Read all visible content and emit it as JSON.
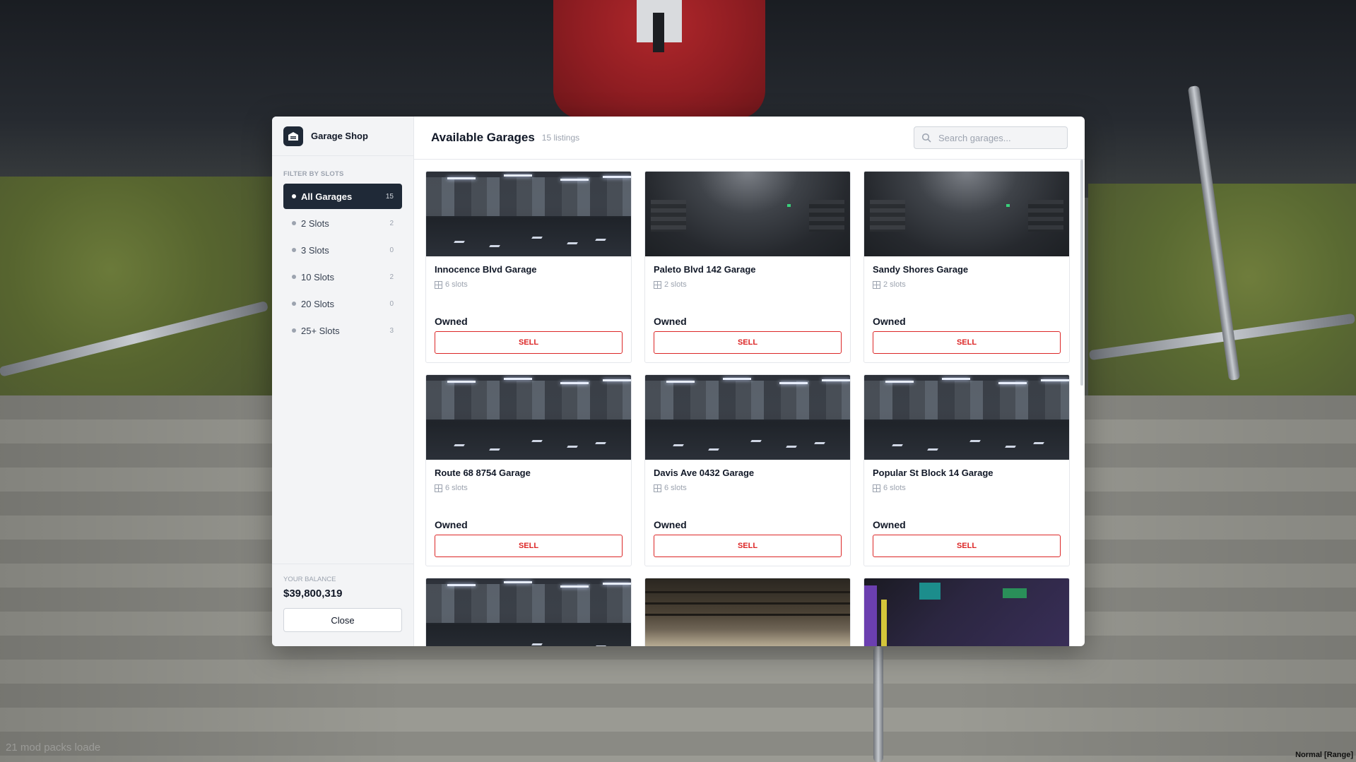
{
  "brand": {
    "title": "Garage Shop",
    "icon": "garage-icon"
  },
  "sidebar": {
    "filter_heading": "FILTER BY SLOTS",
    "filters": [
      {
        "label": "All Garages",
        "count": "15",
        "active": true
      },
      {
        "label": "2 Slots",
        "count": "2",
        "active": false
      },
      {
        "label": "3 Slots",
        "count": "0",
        "active": false
      },
      {
        "label": "10 Slots",
        "count": "2",
        "active": false
      },
      {
        "label": "20 Slots",
        "count": "0",
        "active": false
      },
      {
        "label": "25+ Slots",
        "count": "3",
        "active": false
      }
    ],
    "balance_label": "YOUR BALANCE",
    "balance_value": "$39,800,319",
    "close_label": "Close"
  },
  "header": {
    "title": "Available Garages",
    "listing_count": "15 listings",
    "search_placeholder": "Search garages...",
    "search_icon": "search-icon"
  },
  "garages": [
    {
      "name": "Innocence Blvd Garage",
      "slots": "6 slots",
      "status": "Owned",
      "action": "SELL",
      "thumb": "lit"
    },
    {
      "name": "Paleto Blvd 142 Garage",
      "slots": "2 slots",
      "status": "Owned",
      "action": "SELL",
      "thumb": "dark"
    },
    {
      "name": "Sandy Shores Garage",
      "slots": "2 slots",
      "status": "Owned",
      "action": "SELL",
      "thumb": "dark"
    },
    {
      "name": "Route 68 8754 Garage",
      "slots": "6 slots",
      "status": "Owned",
      "action": "SELL",
      "thumb": "lit"
    },
    {
      "name": "Davis Ave 0432 Garage",
      "slots": "6 slots",
      "status": "Owned",
      "action": "SELL",
      "thumb": "lit"
    },
    {
      "name": "Popular St Block 14 Garage",
      "slots": "6 slots",
      "status": "Owned",
      "action": "SELL",
      "thumb": "lit"
    },
    {
      "name": "",
      "slots": "",
      "status": "",
      "action": "",
      "thumb": "lit"
    },
    {
      "name": "",
      "slots": "",
      "status": "",
      "action": "",
      "thumb": "warehouse"
    },
    {
      "name": "",
      "slots": "",
      "status": "",
      "action": "",
      "thumb": "club"
    }
  ],
  "overlay": {
    "bottom_left": "21 mod packs loade",
    "bottom_right": "Normal [Range]"
  },
  "colors": {
    "accent_dark": "#1f2937",
    "sell_red": "#dc2626",
    "panel": "#ffffff",
    "sidebar_bg": "#f3f4f6"
  }
}
